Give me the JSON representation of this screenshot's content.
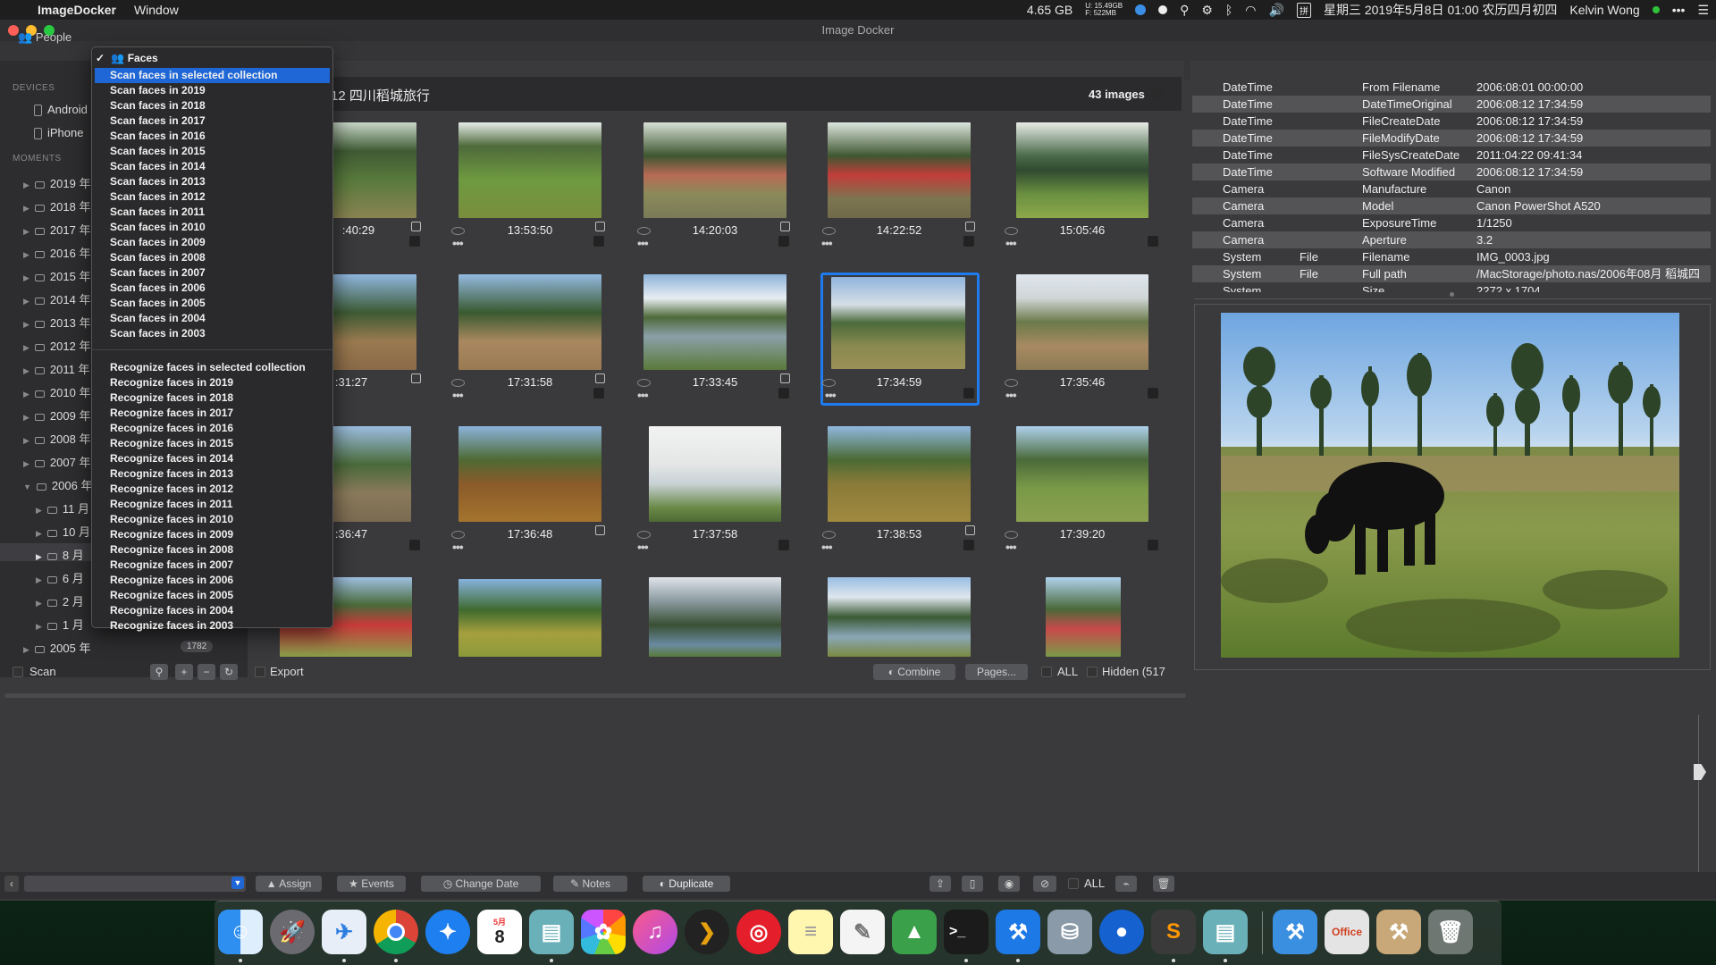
{
  "menubar": {
    "app_name": "ImageDocker",
    "menu_window": "Window",
    "disk": "4.65 GB",
    "net_up": "U: 15.49GB",
    "net_down": "F:   522MB",
    "datetime": "星期三 2019年5月8日 01:00 农历四月初四",
    "user": "Kelvin Wong",
    "more": "•••"
  },
  "window": {
    "title": "Image Docker"
  },
  "toolbar": {
    "people": "People"
  },
  "sidebar": {
    "devices_header": "DEVICES",
    "devices": [
      "Android",
      "iPhone"
    ],
    "moments_header": "MOMENTS",
    "years": [
      "2019 年",
      "2018 年",
      "2017 年",
      "2016 年",
      "2015 年",
      "2014 年",
      "2013 年",
      "2012 年",
      "2011 年",
      "2010 年",
      "2009 年",
      "2008 年",
      "2007 年",
      "2006 年"
    ],
    "months_2006": [
      "11 月",
      "10 月",
      "8 月",
      "6 月",
      "2 月",
      "1 月"
    ],
    "year_2005": "2005 年",
    "year_2005_count": "1782",
    "scan_label": "Scan"
  },
  "dropdown": {
    "header": "Faces",
    "check": "✓",
    "scan_items": [
      "Scan faces in selected collection",
      "Scan faces in 2019",
      "Scan faces in 2018",
      "Scan faces in 2017",
      "Scan faces in 2016",
      "Scan faces in 2015",
      "Scan faces in 2014",
      "Scan faces in 2013",
      "Scan faces in 2012",
      "Scan faces in 2011",
      "Scan faces in 2010",
      "Scan faces in 2009",
      "Scan faces in 2008",
      "Scan faces in 2007",
      "Scan faces in 2006",
      "Scan faces in 2005",
      "Scan faces in 2004",
      "Scan faces in 2003"
    ],
    "recognize_items": [
      "Recognize faces in selected collection",
      "Recognize faces in 2019",
      "Recognize faces in 2018",
      "Recognize faces in 2017",
      "Recognize faces in 2016",
      "Recognize faces in 2015",
      "Recognize faces in 2014",
      "Recognize faces in 2013",
      "Recognize faces in 2012",
      "Recognize faces in 2011",
      "Recognize faces in 2010",
      "Recognize faces in 2009",
      "Recognize faces in 2008",
      "Recognize faces in 2007",
      "Recognize faces in 2006",
      "Recognize faces in 2005",
      "Recognize faces in 2004",
      "Recognize faces in 2003"
    ]
  },
  "collection": {
    "title": "12 四川稻城旅行",
    "count": "43 images"
  },
  "thumbs": {
    "row1": [
      ":40:29",
      "13:53:50",
      "14:20:03",
      "14:22:52",
      "15:05:46"
    ],
    "row2": [
      ":31:27",
      "17:31:58",
      "17:33:45",
      "17:34:59",
      "17:35:46"
    ],
    "row3": [
      ":36:47",
      "17:36:48",
      "17:37:58",
      "17:38:53",
      "17:39:20"
    ]
  },
  "grid_footer": {
    "export": "Export",
    "combine": "Combine",
    "pages": "Pages...",
    "all": "ALL",
    "hidden": "Hidden (517"
  },
  "properties": [
    [
      "DateTime",
      "",
      "From Filename",
      "2006:08:01 00:00:00"
    ],
    [
      "DateTime",
      "",
      "DateTimeOriginal",
      "2006:08:12 17:34:59"
    ],
    [
      "DateTime",
      "",
      "FileCreateDate",
      "2006:08:12 17:34:59"
    ],
    [
      "DateTime",
      "",
      "FileModifyDate",
      "2006:08:12 17:34:59"
    ],
    [
      "DateTime",
      "",
      "FileSysCreateDate",
      "2011:04:22 09:41:34"
    ],
    [
      "DateTime",
      "",
      "Software Modified",
      "2006:08:12 17:34:59"
    ],
    [
      "Camera",
      "",
      "Manufacture",
      "Canon"
    ],
    [
      "Camera",
      "",
      "Model",
      "Canon PowerShot A520"
    ],
    [
      "Camera",
      "",
      "ExposureTime",
      "1/1250"
    ],
    [
      "Camera",
      "",
      "Aperture",
      "3.2"
    ],
    [
      "System",
      "File",
      "Filename",
      "IMG_0003.jpg"
    ],
    [
      "System",
      "File",
      "Full path",
      "/MacStorage/photo.nas/2006年08月 稻城四"
    ],
    [
      "System",
      "",
      "Size",
      "2272 x 1704"
    ]
  ],
  "bottom_toolbar": {
    "assign": "Assign",
    "events": "Events",
    "change_date": "Change Date",
    "notes": "Notes",
    "duplicate": "Duplicate",
    "all": "ALL"
  },
  "dock": {
    "calendar_month": "5月",
    "calendar_day": "8"
  },
  "colors": {
    "selection_blue": "#1f67d6",
    "thumb_selected_border": "#1f7cf0",
    "window_bg": "#3a3a3c"
  }
}
